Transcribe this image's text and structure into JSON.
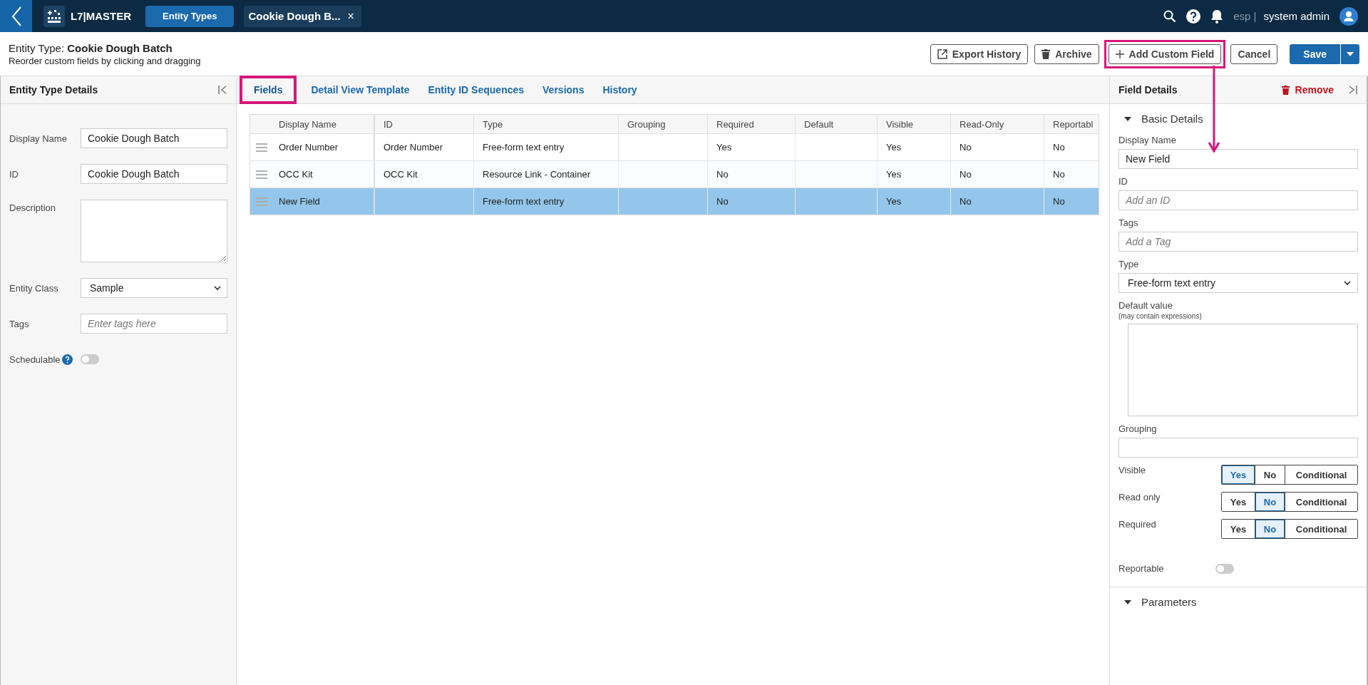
{
  "topbar": {
    "app_name": "L7|MASTER",
    "nav_button": "Entity Types",
    "open_tab": {
      "label": "Cookie Dough B...",
      "close": "×"
    },
    "env": "esp |",
    "user": "system admin"
  },
  "header": {
    "title": "Entity Type: **Cookie Dough Batch**",
    "subtitle": "Reorder custom fields by clicking and dragging",
    "actions": [
      {
        "kind": "export",
        "label": "Export History",
        "highlighted": false
      },
      {
        "kind": "archive",
        "label": "Archive",
        "highlighted": false
      },
      {
        "kind": "add",
        "label": "Add Custom Field",
        "highlighted": true
      },
      {
        "kind": "plain",
        "label": "Cancel",
        "highlighted": false
      },
      {
        "kind": "primary",
        "label": "Save",
        "highlighted": false
      }
    ]
  },
  "left_panel": {
    "title": "Entity Type Details",
    "fields": [
      {
        "kind": "input",
        "label": "Display Name",
        "value": "Cookie Dough Batch"
      },
      {
        "kind": "input",
        "label": "ID",
        "value": "Cookie Dough Batch"
      },
      {
        "kind": "textarea",
        "label": "Description"
      },
      {
        "kind": "select",
        "label": "Entity Class",
        "value": "Sample"
      },
      {
        "kind": "input",
        "label": "Tags",
        "placeholder": "Enter tags here"
      },
      {
        "kind": "toggle",
        "label": "Schedulable",
        "help": true,
        "on": false
      }
    ]
  },
  "tabs": [
    {
      "label": "Fields",
      "selected": true,
      "highlighted": true
    },
    {
      "label": "Detail View Template",
      "selected": false,
      "highlighted": false
    },
    {
      "label": "Entity ID Sequences",
      "selected": false,
      "highlighted": false
    },
    {
      "label": "Versions",
      "selected": false,
      "highlighted": false
    },
    {
      "label": "History",
      "selected": false,
      "highlighted": false
    }
  ],
  "table": {
    "columns": [
      "Display Name",
      "ID",
      "Type",
      "Grouping",
      "Required",
      "Default",
      "Visible",
      "Read-Only",
      "Reportabl"
    ],
    "rows": [
      {
        "selected": false,
        "cells": [
          "Order Number",
          "Order Number",
          "Free-form text entry",
          "",
          "Yes",
          "",
          "Yes",
          "No",
          "No"
        ]
      },
      {
        "selected": false,
        "cells": [
          "OCC Kit",
          "OCC Kit",
          "Resource Link - Container",
          "",
          "No",
          "",
          "Yes",
          "No",
          "No"
        ]
      },
      {
        "selected": true,
        "cells": [
          "New Field",
          "",
          "Free-form text entry",
          "",
          "No",
          "",
          "Yes",
          "No",
          "No"
        ]
      }
    ]
  },
  "right_panel": {
    "title": "Field Details",
    "remove": "Remove",
    "sections": [
      {
        "title": "Basic Details",
        "expanded": true
      },
      {
        "title": "Parameters",
        "expanded": true
      }
    ],
    "fields": [
      {
        "kind": "input",
        "label": "Display Name",
        "value": "New Field"
      },
      {
        "kind": "input",
        "label": "ID",
        "placeholder": "Add an ID"
      },
      {
        "kind": "input",
        "label": "Tags",
        "placeholder": "Add a Tag"
      },
      {
        "kind": "select",
        "label": "Type",
        "value": "Free-form text entry"
      },
      {
        "kind": "textarea",
        "label": "Default value",
        "hint": "(may contain expressions)"
      },
      {
        "kind": "input",
        "label": "Grouping"
      },
      {
        "kind": "segment",
        "label": "Visible",
        "options": [
          {
            "label": "Yes",
            "selected": true
          },
          {
            "label": "No",
            "selected": false
          },
          {
            "label": "Conditional",
            "selected": false
          }
        ]
      },
      {
        "kind": "segment",
        "label": "Read only",
        "options": [
          {
            "label": "Yes",
            "selected": false
          },
          {
            "label": "No",
            "selected": true
          },
          {
            "label": "Conditional",
            "selected": false
          }
        ]
      },
      {
        "kind": "segment",
        "label": "Required",
        "options": [
          {
            "label": "Yes",
            "selected": false
          },
          {
            "label": "No",
            "selected": true
          },
          {
            "label": "Conditional",
            "selected": false
          }
        ]
      },
      {
        "kind": "toggle",
        "label": "Reportable",
        "on": false
      }
    ]
  }
}
